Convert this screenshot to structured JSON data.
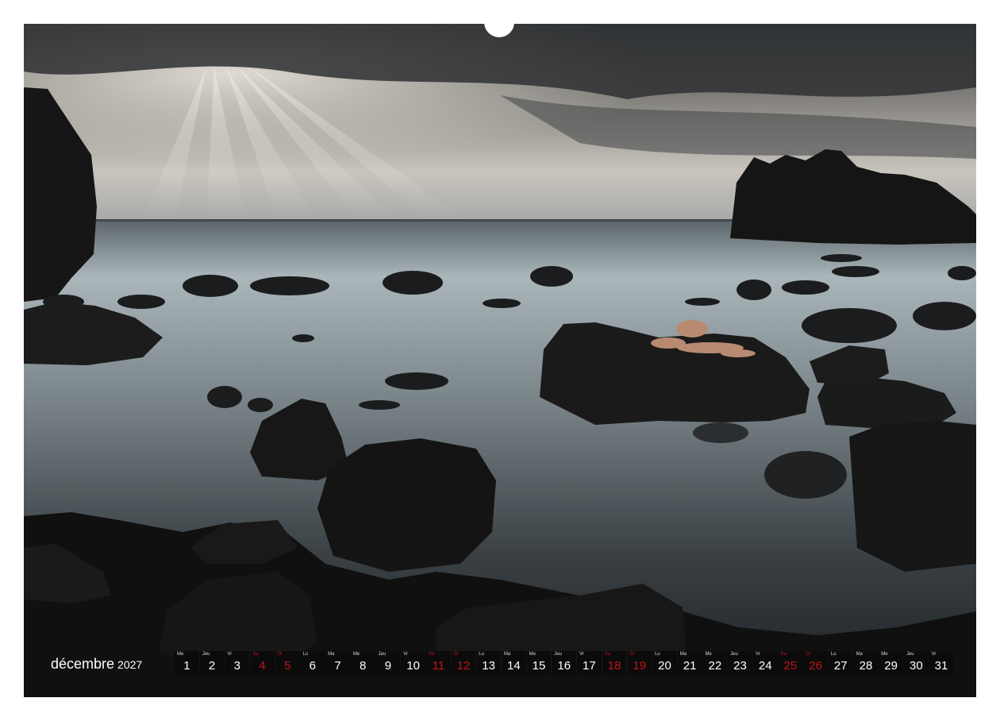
{
  "calendar": {
    "month_label": "décembre",
    "year_label": "2027",
    "days": [
      {
        "dn": "Me",
        "d": "1",
        "weekend": false
      },
      {
        "dn": "Jeu",
        "d": "2",
        "weekend": false
      },
      {
        "dn": "Vr",
        "d": "3",
        "weekend": false
      },
      {
        "dn": "Sa",
        "d": "4",
        "weekend": true
      },
      {
        "dn": "Di",
        "d": "5",
        "weekend": true
      },
      {
        "dn": "Lu",
        "d": "6",
        "weekend": false
      },
      {
        "dn": "Ma",
        "d": "7",
        "weekend": false
      },
      {
        "dn": "Me",
        "d": "8",
        "weekend": false
      },
      {
        "dn": "Jeu",
        "d": "9",
        "weekend": false
      },
      {
        "dn": "Vr",
        "d": "10",
        "weekend": false
      },
      {
        "dn": "Sa",
        "d": "11",
        "weekend": true
      },
      {
        "dn": "Di",
        "d": "12",
        "weekend": true
      },
      {
        "dn": "Lu",
        "d": "13",
        "weekend": false
      },
      {
        "dn": "Ma",
        "d": "14",
        "weekend": false
      },
      {
        "dn": "Me",
        "d": "15",
        "weekend": false
      },
      {
        "dn": "Jeu",
        "d": "16",
        "weekend": false
      },
      {
        "dn": "Vr",
        "d": "17",
        "weekend": false
      },
      {
        "dn": "Sa",
        "d": "18",
        "weekend": true
      },
      {
        "dn": "Di",
        "d": "19",
        "weekend": true
      },
      {
        "dn": "Lu",
        "d": "20",
        "weekend": false
      },
      {
        "dn": "Ma",
        "d": "21",
        "weekend": false
      },
      {
        "dn": "Me",
        "d": "22",
        "weekend": false
      },
      {
        "dn": "Jeu",
        "d": "23",
        "weekend": false
      },
      {
        "dn": "Vr",
        "d": "24",
        "weekend": false
      },
      {
        "dn": "Sa",
        "d": "25",
        "weekend": true
      },
      {
        "dn": "Di",
        "d": "26",
        "weekend": true
      },
      {
        "dn": "Lu",
        "d": "27",
        "weekend": false
      },
      {
        "dn": "Ma",
        "d": "28",
        "weekend": false
      },
      {
        "dn": "Me",
        "d": "29",
        "weekend": false
      },
      {
        "dn": "Jeu",
        "d": "30",
        "weekend": false
      },
      {
        "dn": "Vr",
        "d": "31",
        "weekend": false
      }
    ]
  },
  "photo": {
    "subject": "seascape-with-rocks-and-sun-rays",
    "colors": {
      "sky_light": "#d9d6cf",
      "sky_dark": "#3f4143",
      "sea_mist": "#b8c3c7",
      "sea_dark": "#2c3236",
      "rock": "#1a1a1a",
      "skin": "#b88a72",
      "weekend_red": "#c0141a"
    }
  }
}
